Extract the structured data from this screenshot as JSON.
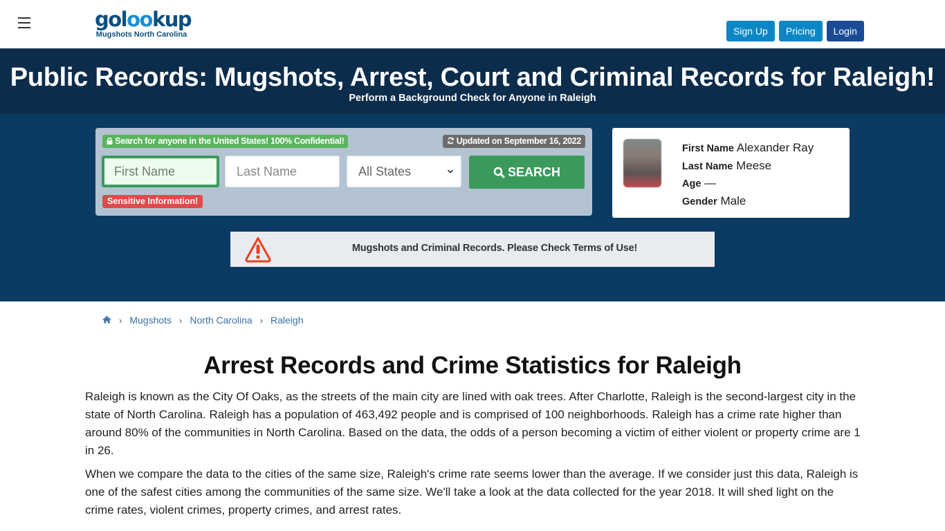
{
  "header": {
    "menu_icon": "hamburger-icon",
    "logo": {
      "word_prefix": "gol",
      "word_oo": "oo",
      "word_suffix": "kup",
      "subtitle": "Mugshots North Carolina"
    },
    "buttons": {
      "signup": "Sign Up",
      "pricing": "Pricing",
      "login": "Login"
    },
    "colors": {
      "signup": "#0d86c6",
      "pricing": "#0d86c6",
      "login": "#1c4b96"
    }
  },
  "hero": {
    "title": "Public Records: Mugshots, Arrest, Court and Criminal Records for Raleigh!",
    "subtitle": "Perform a Background Check for Anyone in Raleigh"
  },
  "search": {
    "confidential_badge": "Search for anyone in the United States! 100% Confidential!",
    "confidential_icon": "lock-icon",
    "updated_badge": "Updated on September 16, 2022",
    "updated_icon": "refresh-icon",
    "first_name_placeholder": "First Name",
    "last_name_placeholder": "Last Name",
    "state_selected": "All States",
    "search_button": "SEARCH",
    "search_icon": "search-icon",
    "sensitive_badge": "Sensitive Information!"
  },
  "person": {
    "first_name_label": "First Name",
    "first_name": "Alexander Ray",
    "last_name_label": "Last Name",
    "last_name": "Meese",
    "age_label": "Age",
    "age": "—",
    "gender_label": "Gender",
    "gender": "Male"
  },
  "warning": {
    "icon": "warning-triangle-icon",
    "text": "Mugshots and Criminal Records. Please Check Terms of Use!"
  },
  "breadcrumb": {
    "home_icon": "home-icon",
    "items": [
      "Mugshots",
      "North Carolina",
      "Raleigh"
    ]
  },
  "article": {
    "title": "Arrest Records and Crime Statistics for Raleigh",
    "paragraphs": [
      "Raleigh is known as the City Of Oaks, as the streets of the main city are lined with oak trees. After Charlotte, Raleigh is the second-largest city in the state of North Carolina. Raleigh has a population of 463,492 people and is comprised of 100 neighborhoods. Raleigh has a crime rate higher than around 80% of the communities in North Carolina. Based on the data, the odds of a person becoming a victim of either violent or property crime are 1 in 26.",
      "When we compare the data to the cities of the same size, Raleigh's crime rate seems lower than the average. If we consider just this data, Raleigh is one of the safest cities among the communities of the same size. We'll take a look at the data collected for the year 2018. It will shed light on the crime rates, violent crimes, property crimes, and arrest rates."
    ]
  }
}
